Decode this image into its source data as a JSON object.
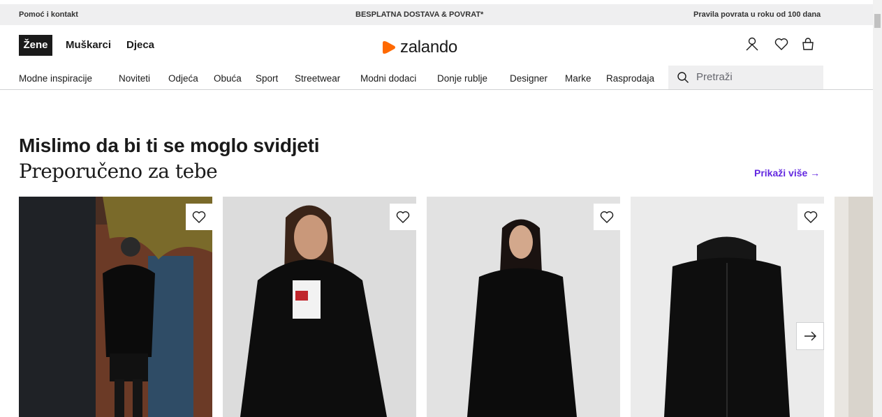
{
  "topbar": {
    "help": "Pomoć i kontakt",
    "shipping": "BESPLATNA DOSTAVA & POVRAT*",
    "returns": "Pravila povrata u roku od 100 dana"
  },
  "header": {
    "genders": [
      "Žene",
      "Muškarci",
      "Djeca"
    ],
    "logo": "zalando",
    "accent": "#ff6900"
  },
  "nav": {
    "items": [
      "Modne inspiracije",
      "Noviteti",
      "Odjeća",
      "Obuća",
      "Sport",
      "Streetwear",
      "Modni dodaci",
      "Donje rublje",
      "Designer",
      "Marke",
      "Rasprodaja"
    ],
    "search_placeholder": "Pretraži"
  },
  "section": {
    "title": "Mislimo da bi ti se moglo svidjeti",
    "subtitle": "Preporučeno za tebe",
    "show_more": "Prikaži više →"
  },
  "products": [
    {
      "icon": "heart-icon"
    },
    {
      "icon": "heart-icon"
    },
    {
      "icon": "heart-icon"
    },
    {
      "icon": "heart-icon"
    }
  ]
}
